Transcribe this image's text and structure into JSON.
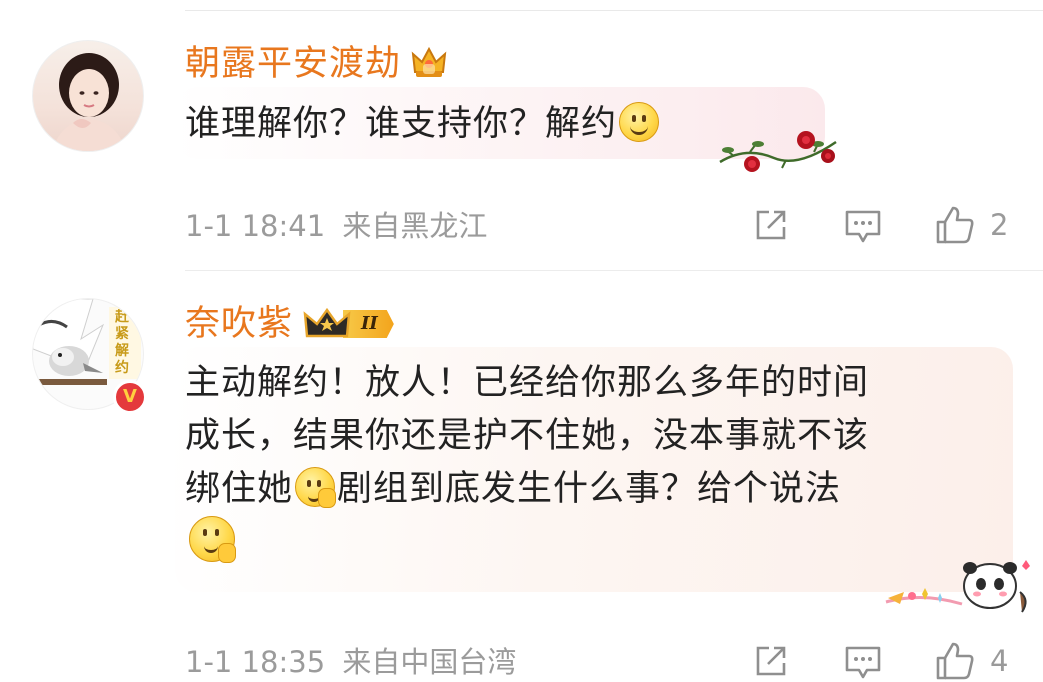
{
  "comments": [
    {
      "username": "朝露平安渡劫",
      "text": "谁理解你？谁支持你？解约",
      "time": "1-1 18:41",
      "location": "来自黑龙江",
      "likes": "2"
    },
    {
      "username": "奈吹紫",
      "level_badge": "II",
      "text_line1": "主动解约！放人！已经给你那么多年的时间",
      "text_line2": "成长，结果你还是护不住她，没本事就不该",
      "text_line3a": "绑住她",
      "text_line3b": "剧组到底发生什么事？给个说法",
      "avatar_text": "赶紧解约",
      "verified_mark": "V",
      "time": "1-1 18:35",
      "location": "来自中国台湾",
      "likes": "4"
    }
  ],
  "colors": {
    "username": "#e8771e",
    "body_text": "#222222",
    "meta": "#9b9b9b",
    "crown": "#f2a51a",
    "verified": "#e4393c"
  },
  "icons": [
    "crown-icon",
    "smile-emoji",
    "rose-vine-decoration",
    "share-icon",
    "comment-icon",
    "like-icon",
    "verified-badge",
    "panda-sticker"
  ]
}
